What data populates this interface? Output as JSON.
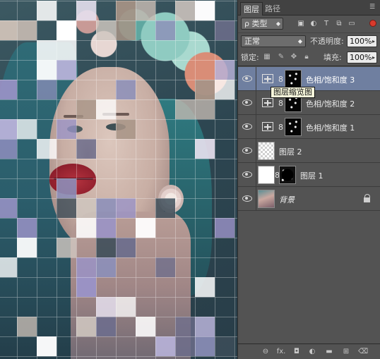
{
  "panel": {
    "tabs": [
      {
        "label": "图层",
        "active": true
      },
      {
        "label": "路径",
        "active": false
      }
    ],
    "menu_icon": "panel-menu-icon"
  },
  "filter": {
    "kind_label": "ρ 类型",
    "icons": [
      "image-filter-icon",
      "adjustment-filter-icon",
      "type-filter-icon",
      "shape-filter-icon",
      "smart-object-filter-icon"
    ],
    "toggle_color": "#d93a2c"
  },
  "blend": {
    "mode": "正常",
    "opacity_label": "不透明度:",
    "opacity_value": "100%"
  },
  "lock": {
    "label": "锁定:",
    "icons": [
      "lock-transparent-icon",
      "lock-image-icon",
      "lock-position-icon",
      "lock-all-icon"
    ],
    "fill_label": "填充:",
    "fill_value": "100%"
  },
  "layers": [
    {
      "name": "色相/饱和度 3",
      "type": "adjustment",
      "selected": true,
      "mask": "dots"
    },
    {
      "name": "色相/饱和度 2",
      "type": "adjustment",
      "selected": false,
      "mask": "dots"
    },
    {
      "name": "色相/饱和度 1",
      "type": "adjustment",
      "selected": false,
      "mask": "dots"
    },
    {
      "name": "图层 2",
      "type": "transparent",
      "selected": false
    },
    {
      "name": "图层 1",
      "type": "white-with-mask",
      "selected": false
    },
    {
      "name": "背景",
      "type": "background",
      "selected": false,
      "locked": true
    }
  ],
  "tooltip": "图层缩览图",
  "bottom_icons": [
    "link-layers-icon",
    "fx-icon",
    "add-mask-icon",
    "new-adjustment-icon",
    "new-group-icon",
    "new-layer-icon",
    "trash-icon"
  ],
  "bottom_labels": [
    "⊖",
    "fx.",
    "◘",
    "◐",
    "▬",
    "⊞",
    "⌫"
  ],
  "colors": {
    "panel_bg": "#535353",
    "selected_layer": "#6f7fa0",
    "tooltip_bg": "#f7f7dc"
  }
}
